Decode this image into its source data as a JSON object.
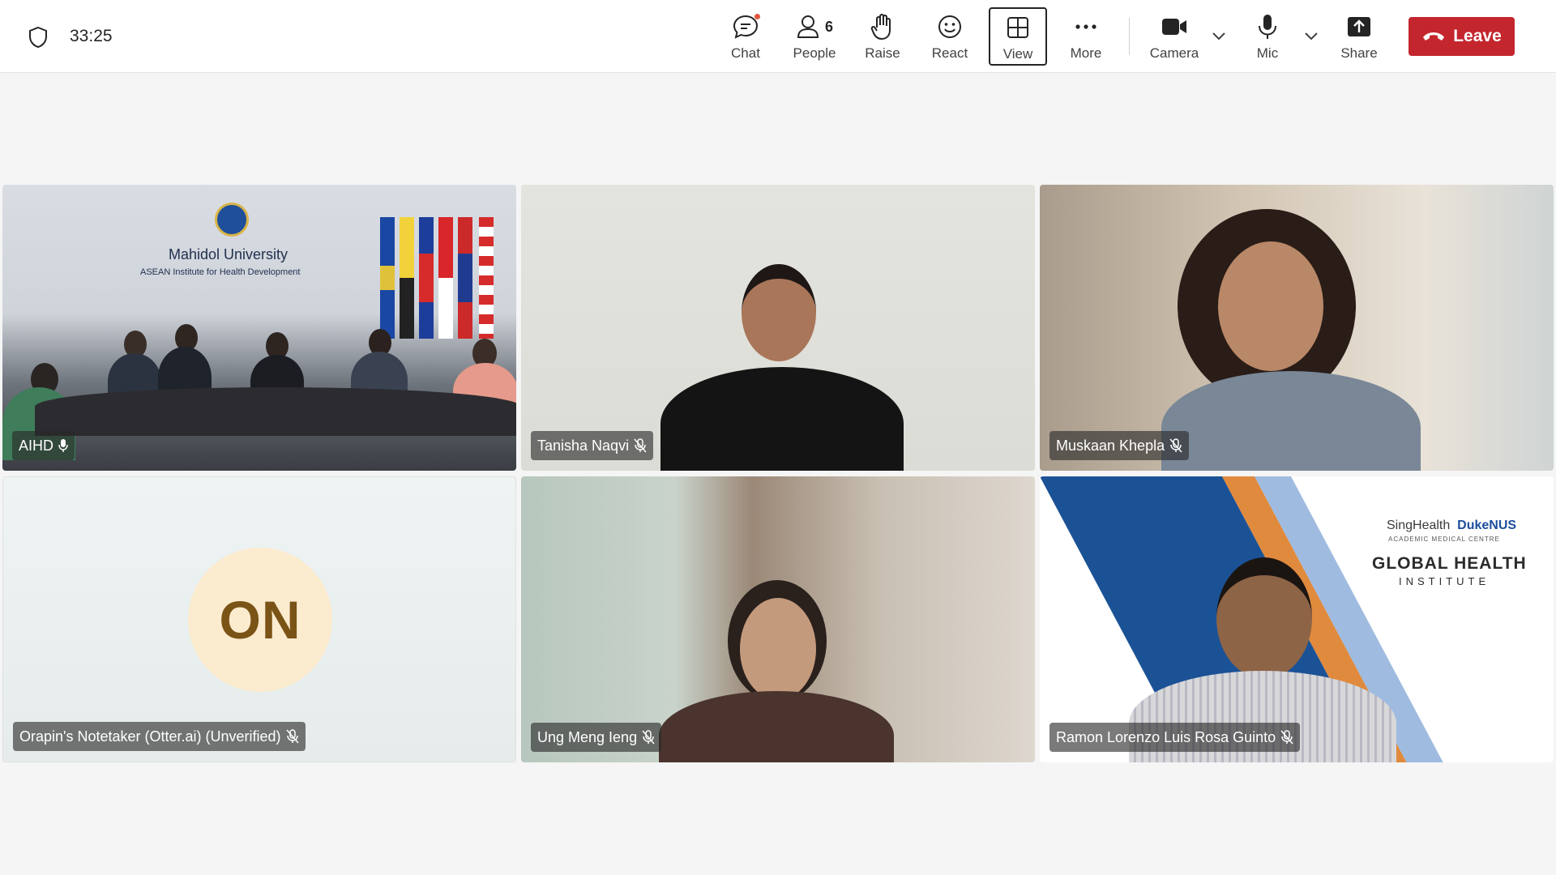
{
  "meeting": {
    "timer": "33:25"
  },
  "toolbar": {
    "chat_label": "Chat",
    "people_label": "People",
    "people_count": "6",
    "raise_label": "Raise",
    "react_label": "React",
    "view_label": "View",
    "more_label": "More",
    "camera_label": "Camera",
    "mic_label": "Mic",
    "share_label": "Share",
    "leave_label": "Leave"
  },
  "participants": [
    {
      "name": "AIHD",
      "muted": false
    },
    {
      "name": "Tanisha Naqvi",
      "muted": true
    },
    {
      "name": "Muskaan Khepla",
      "muted": true
    },
    {
      "name": "Orapin's Notetaker (Otter.ai) (Unverified)",
      "muted": true,
      "initials": "ON"
    },
    {
      "name": "Ung Meng Ieng",
      "muted": true
    },
    {
      "name": "Ramon Lorenzo Luis Rosa Guinto",
      "muted": true
    }
  ],
  "aihd_backdrop": {
    "title": "Mahidol University",
    "subtitle": "ASEAN Institute for Health Development"
  },
  "ghi_backdrop": {
    "brand_left": "SingHealth",
    "brand_right": "DukeNUS",
    "brand_small": "ACADEMIC MEDICAL CENTRE",
    "title": "GLOBAL HEALTH",
    "subtitle": "INSTITUTE"
  },
  "colors": {
    "leave_button": "#c4262e",
    "notification_dot": "#e0563f",
    "avatar_bg": "#fbebcf",
    "avatar_text": "#7a5316"
  },
  "icons": {
    "security": "shield-icon",
    "chat": "chat-icon",
    "people": "people-icon",
    "raise": "hand-icon",
    "react": "smiley-icon",
    "view": "grid-icon",
    "more": "ellipsis-icon",
    "camera": "video-camera-icon",
    "mic": "microphone-icon",
    "share": "share-upload-icon",
    "leave": "phone-hangup-icon"
  }
}
